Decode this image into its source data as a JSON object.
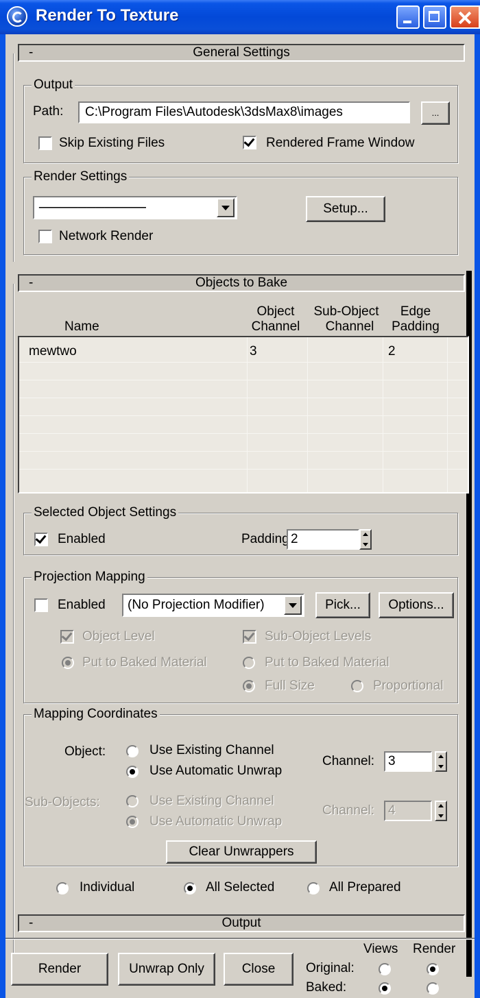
{
  "window": {
    "title": "Render To Texture",
    "icon": "3dsmax-logo-icon"
  },
  "general_settings": {
    "header": "General Settings",
    "collapse_symbol": "-",
    "output_group": {
      "label": "Output",
      "path_label": "Path:",
      "path_value": "C:\\Program Files\\Autodesk\\3dsMax8\\images",
      "browse_label": "...",
      "skip_existing": {
        "label": "Skip Existing Files",
        "checked": false
      },
      "rendered_frame_window": {
        "label": "Rendered Frame Window",
        "checked": true
      }
    },
    "render_settings_group": {
      "label": "Render Settings",
      "preset_value": "------------------------------------",
      "setup_label": "Setup...",
      "network_render": {
        "label": "Network Render",
        "checked": false
      }
    }
  },
  "objects_to_bake": {
    "header": "Objects to Bake",
    "collapse_symbol": "-",
    "columns": {
      "name": "Name",
      "object_channel_1": "Object",
      "object_channel_2": "Channel",
      "subobject_channel_1": "Sub-Object",
      "subobject_channel_2": "Channel",
      "edge_padding_1": "Edge",
      "edge_padding_2": "Padding"
    },
    "rows": [
      {
        "name": "mewtwo",
        "object_channel": "3",
        "subobject_channel": "",
        "edge_padding": "2"
      }
    ],
    "selected_object_settings": {
      "label": "Selected Object Settings",
      "enabled": {
        "label": "Enabled",
        "checked": true
      },
      "padding_label": "Padding:",
      "padding_value": "2"
    },
    "projection_mapping": {
      "label": "Projection Mapping",
      "enabled": {
        "label": "Enabled",
        "checked": false
      },
      "modifier_value": "(No Projection Modifier)",
      "pick_label": "Pick...",
      "options_label": "Options...",
      "object_level": {
        "label": "Object Level",
        "checked": true
      },
      "sub_object_levels": {
        "label": "Sub-Object Levels",
        "checked": true
      },
      "put_to_baked_material_left": "Put to Baked Material",
      "put_to_baked_material_right": "Put to Baked Material",
      "full_size": "Full Size",
      "proportional": "Proportional"
    },
    "mapping_coordinates": {
      "label": "Mapping Coordinates",
      "object_label": "Object:",
      "use_existing_channel": "Use Existing Channel",
      "use_automatic_unwrap": "Use Automatic Unwrap",
      "channel_label": "Channel:",
      "object_channel_value": "3",
      "sub_objects_label": "Sub-Objects:",
      "sub_use_existing_channel": "Use Existing Channel",
      "sub_use_automatic_unwrap": "Use Automatic Unwrap",
      "sub_channel_label": "Channel:",
      "sub_channel_value": "4",
      "clear_unwrappers_label": "Clear Unwrappers"
    },
    "scope": {
      "individual": "Individual",
      "all_selected": "All Selected",
      "all_prepared": "All Prepared",
      "selected": "All Selected"
    }
  },
  "output_rollout": {
    "header": "Output",
    "collapse_symbol": "-"
  },
  "footer": {
    "render_label": "Render",
    "unwrap_only_label": "Unwrap Only",
    "close_label": "Close",
    "views_label": "Views",
    "render_col_label": "Render",
    "original_label": "Original:",
    "baked_label": "Baked:"
  }
}
